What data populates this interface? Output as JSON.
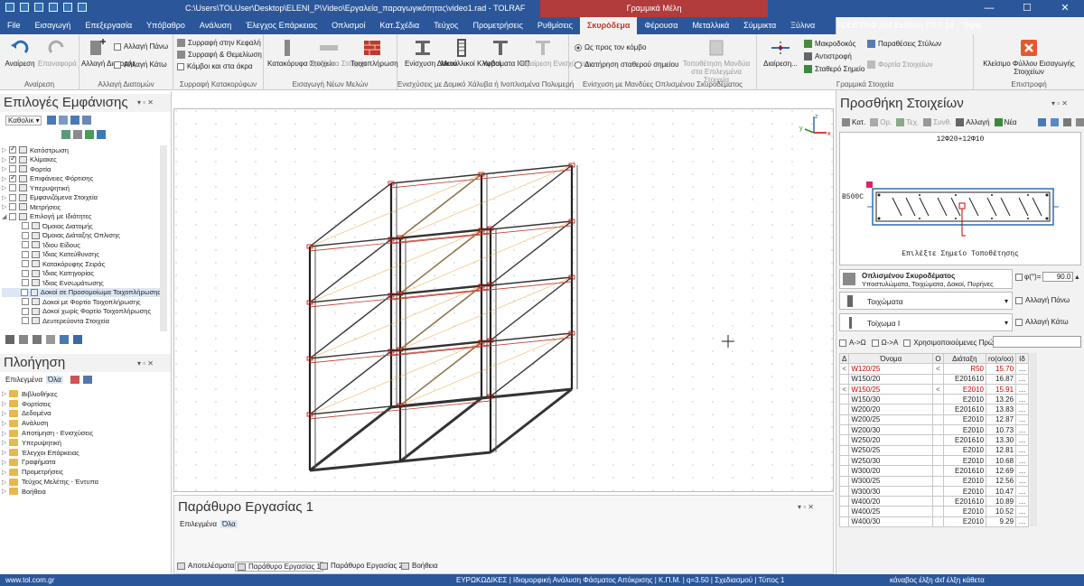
{
  "title_bar": {
    "path": "C:\\Users\\TOLUser\\Desktop\\ELENI_P\\Video\\Εργαλεία_παραγωγικότητας\\video1.rad - TOLRAF",
    "context_tab": "Γραμμικά Μέλη",
    "minimize": "—",
    "maximize": "☐",
    "close": "✕"
  },
  "tabs": [
    "File",
    "Εισαγωγή",
    "Επεξεργασία",
    "Υπόβαθρο",
    "Ανάλυση",
    "Έλεγχος Επάρκειας",
    "Οπλισμοί",
    "Κατ.Σχέδια",
    "Τεύχος",
    "Προμετρήσεις",
    "Ρυθμίσεις",
    "Σκυρόδεμα",
    "Φέρουσα",
    "Μεταλλικά",
    "Σύμμικτα",
    "Ξύλινα"
  ],
  "active_tab": "Σκυρόδεμα",
  "tabs_right": {
    "version": "TOL® ΡΑΦ x64 Εκδοση 7.0.7.14",
    "style": "Style"
  },
  "ribbon": {
    "analysis": {
      "reanalysis": "Αναίρεση",
      "restore": "Επαναφορά",
      "caption": "Αναίρεση"
    },
    "sections": {
      "change_section": "Αλλαγή Διατομής",
      "change_top": "Αλλαγή Πάνω",
      "change_bottom": "Αλλαγή Κάτω",
      "caption": "Αλλαγή Διατομών"
    },
    "shrink": {
      "head": "Συρραφή στην Κεφαλή",
      "foundation": "Συρραφή & Θεμελίωση",
      "nodes": "Κόμβοι και στα άκρα",
      "caption": "Συρραφή Κατακορύφων"
    },
    "new_members": {
      "vertical": "Κατακόρυφα Στοιχεία",
      "horizontal": "Οριζόντια Στοιχεία",
      "masonry": "Τοιχοπλήρωση",
      "caption": "Εισαγωγή Νέων Μελών"
    },
    "reinforce": {
      "beam": "Ενίσχυση Δοκού",
      "cages": "Μεταλλικοί Κλωβοί",
      "fabric": "Υφάσματα ΙΟΠ",
      "remove": "Αφαίρεση Ενισχύσεων",
      "caption": "Ενισχύσεις με Δομικό Χάλυβα ή Ινοπλισμένα Πολυμερή"
    },
    "jackets": {
      "toward_node": "Ως προς τον κόμβο",
      "keep_point": "Διατήρηση σταθερού σημείου",
      "place": "Τοποθέτηση Μανδύα στα Επιλεγμένα Στοιχεία",
      "caption": "Ενίσχυση με Μανδύες Οπλισμένου Σκυροδέματος"
    },
    "linear": {
      "split": "Διαίρεση...",
      "macro": "Μακροδοκός",
      "invert": "Αντιστροφή",
      "fixed_point": "Σταθερό Σημείο",
      "style_params": "Παραθέσεις Στύλων",
      "loads_columns": "Φορτία Στοιχείων",
      "caption": "Γραμμικά Στοιχεία"
    },
    "return": {
      "close": "Κλείσιμο Φύλλου Εισαγωγής Στοιχείων",
      "caption": "Επιστροφή"
    }
  },
  "display_options": {
    "title": "Επιλογές Εμφάνισης",
    "filter": "Καθολικ",
    "items": [
      {
        "label": "Κατόστρωση",
        "checked": true,
        "expand": "▷",
        "selected": false
      },
      {
        "label": "Κλίμακες",
        "checked": true,
        "expand": "▷",
        "selected": false
      },
      {
        "label": "Φορτία",
        "checked": false,
        "expand": "▷",
        "selected": false
      },
      {
        "label": "Επιφάνειες Φόρτισης",
        "checked": true,
        "expand": "▷",
        "selected": false
      },
      {
        "label": "Υπερυψητική",
        "checked": false,
        "expand": "▷",
        "selected": false
      },
      {
        "label": "Εμφανιζόμενα Στοιχεία",
        "checked": false,
        "expand": "▷",
        "selected": false
      },
      {
        "label": "Μετρήσεις",
        "checked": false,
        "expand": "▷",
        "selected": false
      },
      {
        "label": "Επιλογή με Ιδιότητες",
        "checked": false,
        "expand": "◢",
        "selected": false
      },
      {
        "label": "Όμοιας Διατομής",
        "checked": false,
        "expand": "",
        "selected": false
      },
      {
        "label": "Όμοιας Διάταξης Οπλισης",
        "checked": false,
        "expand": "",
        "selected": false
      },
      {
        "label": "Ίδιου Είδους",
        "checked": false,
        "expand": "",
        "selected": false
      },
      {
        "label": "Ίδιας Κατεύθυνσης",
        "checked": false,
        "expand": "",
        "selected": false
      },
      {
        "label": "Κατακόρυφης Σειράς",
        "checked": false,
        "expand": "",
        "selected": false
      },
      {
        "label": "Ίδιας Κατηγορίας",
        "checked": false,
        "expand": "",
        "selected": false
      },
      {
        "label": "Ίδιας Ενσωμάτωσης",
        "checked": false,
        "expand": "",
        "selected": false
      },
      {
        "label": "Δοκοί σε Προσομοίωμα Τοιχοπλήρωσης",
        "checked": false,
        "expand": "",
        "selected": true
      },
      {
        "label": "Δοκοί με Φορτίο Τοιχοπλήρωσης",
        "checked": false,
        "expand": "",
        "selected": false
      },
      {
        "label": "Δοκοί χωρίς Φορτίο Τοιχοπλήρωσης",
        "checked": false,
        "expand": "",
        "selected": false
      },
      {
        "label": "Δευτερεύοντα Στοιχεία",
        "checked": false,
        "expand": "",
        "selected": false
      }
    ]
  },
  "navigation": {
    "title": "Πλοήγηση",
    "tab_selected": "Επιλεγμένα",
    "tab_all": "Όλα",
    "items": [
      "Βιβλιοθήκες",
      "Φορτίσεις",
      "Δεδομένα",
      "Ανάλυση",
      "Αποτίμηση - Ενισχύσεις",
      "Υπερυψητική",
      "Έλεγχοι Επάρκειας",
      "Γραφήματα",
      "Προμετρήσεις",
      "Τεύχος Μελέτης - Έντυπα",
      "Βοήθεια"
    ]
  },
  "work_window": {
    "title": "Παράθυρο Εργασίας 1",
    "tab_selected": "Επιλεγμένα",
    "tab_all": "Όλα"
  },
  "bottom_tabs": [
    "Αποτελέσματα",
    "Παράθυρο Εργασίας 1",
    "Παράθυρο Εργασίας 2",
    "Βοήθεια"
  ],
  "add_elements": {
    "title": "Προσθήκη Στοιχείων",
    "toolbar": [
      "Κατ.",
      "Ορ.",
      "Τεχ.",
      "Συνθ.",
      "Αλλαγή",
      "Νέα"
    ],
    "preview_label": "12Φ20+12Φ10",
    "preview_side": "B500C",
    "preview_hint": "Επιλέξτε Σημείο Τοποθέτησης",
    "material_title": "Οπλισμένου Σκυροδέματος",
    "material_sub": "Υποστυλώματα, Τοιχώματα, Δοκοί, Πυρήνες",
    "phi_label": "φ(°)=",
    "phi_value": "90.0",
    "type1": "Τοιχώματα",
    "type2": "Τοίχωμα Ι",
    "change_top": "Αλλαγή Πάνω",
    "change_bottom": "Αλλαγή Κάτω",
    "opt_az": "Α->Ω",
    "opt_za": "Ω->Α",
    "opt_used": "Χρησιμοποιούμενες Πρώτα",
    "headers": [
      "Δ",
      "Όνομα",
      "Ο",
      "Διάταξη",
      "ro(o/oo)",
      "Ιδ"
    ],
    "rows": [
      {
        "d": "<",
        "name": "W120/25",
        "o": "<",
        "arr": "R50",
        "ro": "15.70",
        "red": true
      },
      {
        "d": "",
        "name": "W150/20",
        "o": "",
        "arr": "E201610",
        "ro": "16.87",
        "red": false
      },
      {
        "d": "<",
        "name": "W150/25",
        "o": "<",
        "arr": "E2010",
        "ro": "15.91",
        "red": true
      },
      {
        "d": "",
        "name": "W150/30",
        "o": "",
        "arr": "E2010",
        "ro": "13.26",
        "red": false
      },
      {
        "d": "",
        "name": "W200/20",
        "o": "",
        "arr": "E201610",
        "ro": "13.83",
        "red": false
      },
      {
        "d": "",
        "name": "W200/25",
        "o": "",
        "arr": "E2010",
        "ro": "12.87",
        "red": false
      },
      {
        "d": "",
        "name": "W200/30",
        "o": "",
        "arr": "E2010",
        "ro": "10.73",
        "red": false
      },
      {
        "d": "",
        "name": "W250/20",
        "o": "",
        "arr": "E201610",
        "ro": "13.30",
        "red": false
      },
      {
        "d": "",
        "name": "W250/25",
        "o": "",
        "arr": "E2010",
        "ro": "12.81",
        "red": false
      },
      {
        "d": "",
        "name": "W250/30",
        "o": "",
        "arr": "E2010",
        "ro": "10.68",
        "red": false
      },
      {
        "d": "",
        "name": "W300/20",
        "o": "",
        "arr": "E201610",
        "ro": "12.69",
        "red": false
      },
      {
        "d": "",
        "name": "W300/25",
        "o": "",
        "arr": "E2010",
        "ro": "12.56",
        "red": false
      },
      {
        "d": "",
        "name": "W300/30",
        "o": "",
        "arr": "E2010",
        "ro": "10.47",
        "red": false
      },
      {
        "d": "",
        "name": "W400/20",
        "o": "",
        "arr": "E201610",
        "ro": "10.89",
        "red": false
      },
      {
        "d": "",
        "name": "W400/25",
        "o": "",
        "arr": "E2010",
        "ro": "10.52",
        "red": false
      },
      {
        "d": "",
        "name": "W400/30",
        "o": "",
        "arr": "E2010",
        "ro": "9.29",
        "red": false
      }
    ]
  },
  "status": {
    "url": "www.tol.com.gr",
    "codes": "ΕΥΡΩΚΩΔΙΚΕΣ | Ιδιομορφική Ανάλυση Φάσματος Απόκρισης | Κ.Π.Μ. | q=3.50 | Σχεδιασμού | Τύπος 1",
    "right": "κάναβος   έλξη   dxf  έλξη  κάθετα"
  }
}
